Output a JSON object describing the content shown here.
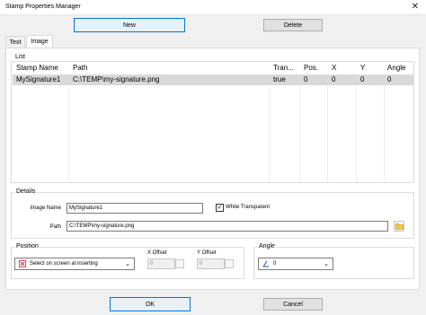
{
  "window": {
    "title": "Stamp Properties Manager"
  },
  "toolbar": {
    "new_label": "New",
    "delete_label": "Delete"
  },
  "tabs": [
    {
      "label": "Text"
    },
    {
      "label": "Image"
    }
  ],
  "list": {
    "group_label": "List",
    "columns": [
      "Stamp Name",
      "Path",
      "Tran...",
      "Pos.",
      "X",
      "Y",
      "Angle"
    ],
    "rows": [
      {
        "name": "MySignature1",
        "path": "C:\\TEMP\\my-signature.png",
        "transparent": "true",
        "pos": "0",
        "x": "0",
        "y": "0",
        "angle": "0"
      }
    ]
  },
  "details": {
    "group_label": "Details",
    "image_name_label": "Image Name",
    "image_name_value": "MySignature1",
    "white_transparent_label": "White Transparent",
    "white_transparent_checked": true,
    "path_label": "Path",
    "path_value": "C:\\TEMP\\my-signature.png"
  },
  "position": {
    "group_label": "Position",
    "mode_value": "Select on screen at inserting",
    "x_offset_label": "X Offset",
    "x_offset_value": "0",
    "y_offset_label": "Y Offset",
    "y_offset_value": "0"
  },
  "angle": {
    "group_label": "Angle",
    "value": "0"
  },
  "footer": {
    "ok_label": "OK",
    "cancel_label": "Cancel"
  },
  "colors": {
    "selected_row": "#d9d9d9",
    "primary_border": "#0078d7",
    "primary_fill": "#e5f1fb"
  }
}
